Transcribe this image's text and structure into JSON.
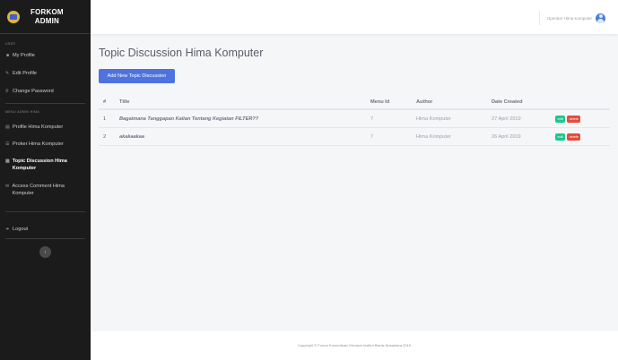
{
  "brand": {
    "line1": "FORKOM",
    "line2": "ADMIN"
  },
  "sidebar": {
    "heading_user": "user",
    "heading_menu": "menu admin hima",
    "items": [
      {
        "label": "My Profile",
        "icon": "user-icon"
      },
      {
        "label": "Edit Profile",
        "icon": "user-edit-icon"
      },
      {
        "label": "Change Password",
        "icon": "key-icon"
      },
      {
        "label": "Profile Hima Komputer",
        "icon": "file-icon"
      },
      {
        "label": "Proker Hima Komputer",
        "icon": "list-icon"
      },
      {
        "label": "Topic Discussion Hima Komputer",
        "icon": "comments-icon",
        "active": true
      },
      {
        "label": "Access Comment Hima Komputer",
        "icon": "comment-icon"
      },
      {
        "label": "Logout",
        "icon": "logout-icon"
      }
    ]
  },
  "topbar": {
    "user_name": "Operator Hima Komputer"
  },
  "page": {
    "title": "Topic Discussion Hima Komputer",
    "add_button": "Add New Topic Discussion"
  },
  "table": {
    "headers": {
      "no": "#",
      "title": "Title",
      "menu_id": "Menu Id",
      "author": "Author",
      "date": "Date Created"
    },
    "rows": [
      {
        "no": "1",
        "title": "Bagaimana Tanggapan Kalian Tentang Kegiatan FILTER??",
        "menu_id": "7",
        "author": "Hima Komputer",
        "date": "27 April 2019",
        "edit": "edit",
        "delete": "delete"
      },
      {
        "no": "2",
        "title": "akakaakaa",
        "menu_id": "7",
        "author": "Hima Komputer",
        "date": "26 April 2019",
        "edit": "edit",
        "delete": "delete"
      }
    ]
  },
  "footer": {
    "text": "Copyright © Forum Komunikasi Ormawa Institut Bisnis Nusantara 2019"
  },
  "colors": {
    "primary": "#4e73df",
    "success": "#1cc88a",
    "danger": "#e74a3b",
    "sidebar": "#1b1b1b"
  }
}
